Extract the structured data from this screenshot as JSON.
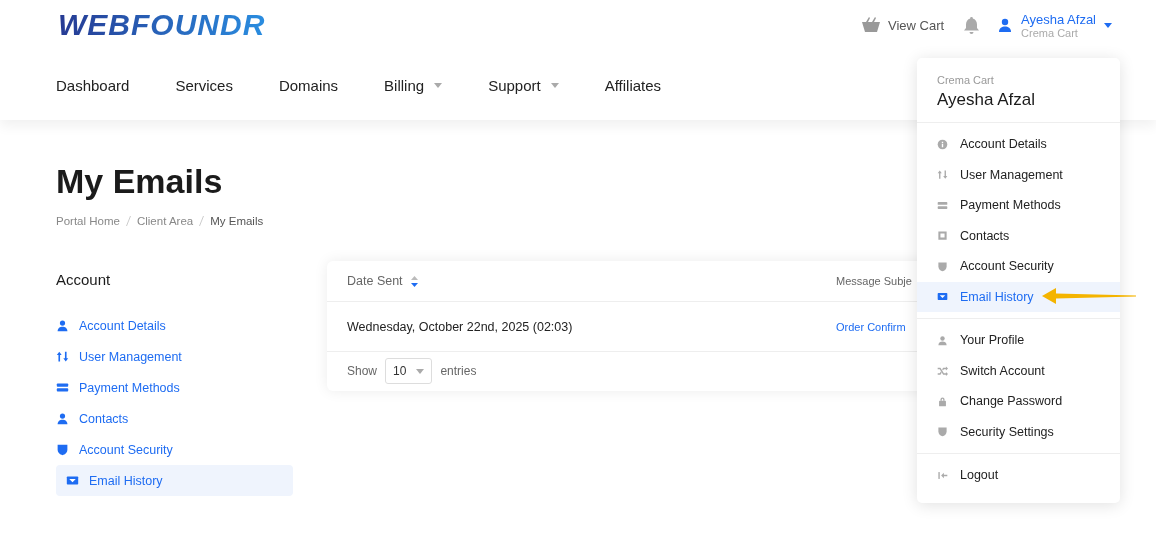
{
  "header": {
    "logo": "WEBFOUNDR",
    "cart": "View Cart",
    "user": {
      "name": "Ayesha Afzal",
      "company": "Crema Cart"
    }
  },
  "nav": [
    {
      "label": "Dashboard",
      "dropdown": false
    },
    {
      "label": "Services",
      "dropdown": false
    },
    {
      "label": "Domains",
      "dropdown": false
    },
    {
      "label": "Billing",
      "dropdown": true
    },
    {
      "label": "Support",
      "dropdown": true
    },
    {
      "label": "Affiliates",
      "dropdown": false
    }
  ],
  "page": {
    "title": "My Emails",
    "breadcrumb": [
      {
        "label": "Portal Home",
        "current": false
      },
      {
        "label": "Client Area",
        "current": false
      },
      {
        "label": "My Emails",
        "current": true
      }
    ]
  },
  "sidebar": {
    "heading": "Account",
    "items": [
      {
        "label": "Account Details",
        "selected": false
      },
      {
        "label": "User Management",
        "selected": false
      },
      {
        "label": "Payment Methods",
        "selected": false
      },
      {
        "label": "Contacts",
        "selected": false
      },
      {
        "label": "Account Security",
        "selected": false
      },
      {
        "label": "Email History",
        "selected": true
      }
    ]
  },
  "table": {
    "columns": [
      "Date Sent",
      "Message Subje"
    ],
    "rows": [
      [
        "Wednesday, October 22nd, 2025 (02:03)",
        "Order Confirm"
      ]
    ],
    "footer": {
      "show": "Show",
      "length": "10",
      "entries": "entries"
    }
  },
  "dropdown": {
    "company": "Crema Cart",
    "name": "Ayesha Afzal",
    "groups": [
      [
        {
          "label": "Account Details",
          "selected": false
        },
        {
          "label": "User Management",
          "selected": false
        },
        {
          "label": "Payment Methods",
          "selected": false
        },
        {
          "label": "Contacts",
          "selected": false
        },
        {
          "label": "Account Security",
          "selected": false
        },
        {
          "label": "Email History",
          "selected": true
        }
      ],
      [
        {
          "label": "Your Profile",
          "selected": false
        },
        {
          "label": "Switch Account",
          "selected": false
        },
        {
          "label": "Change Password",
          "selected": false
        },
        {
          "label": "Security Settings",
          "selected": false
        }
      ],
      [
        {
          "label": "Logout",
          "selected": false
        }
      ]
    ]
  }
}
